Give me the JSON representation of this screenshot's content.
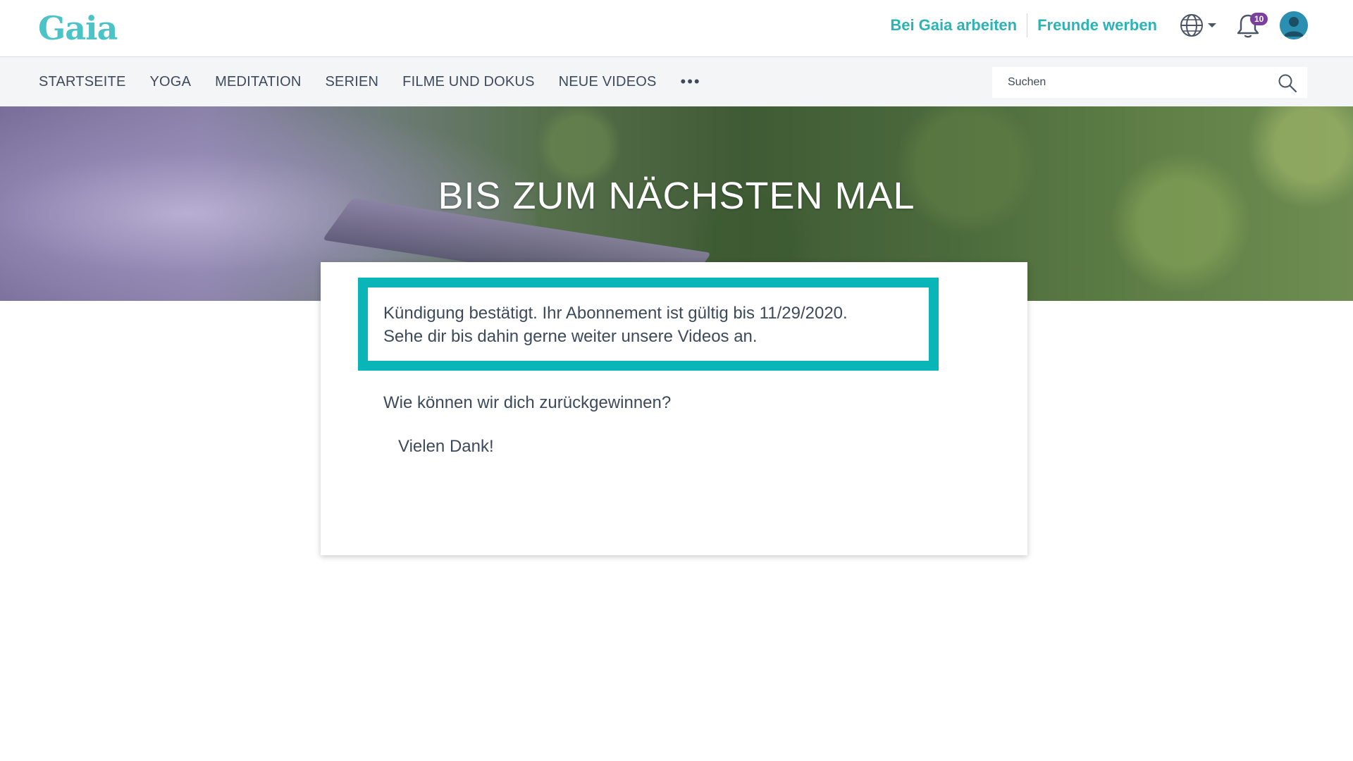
{
  "header": {
    "logo": "Gaia",
    "links": [
      {
        "label": "Bei Gaia arbeiten"
      },
      {
        "label": "Freunde werben"
      }
    ],
    "notification_count": "10",
    "icons": {
      "globe": "globe-icon",
      "caret": "chevron-down-icon",
      "bell": "bell-icon",
      "avatar": "avatar"
    }
  },
  "nav": {
    "items": [
      {
        "label": "STARTSEITE"
      },
      {
        "label": "YOGA"
      },
      {
        "label": "MEDITATION"
      },
      {
        "label": "SERIEN"
      },
      {
        "label": "FILME UND DOKUS"
      },
      {
        "label": "NEUE VIDEOS"
      }
    ],
    "more": "•••",
    "search": {
      "placeholder": "Suchen",
      "value": ""
    }
  },
  "hero": {
    "title": "BIS ZUM NÄCHSTEN MAL"
  },
  "card": {
    "notice_line1": "Kündigung bestätigt. Ihr Abonnement ist gültig bis 11/29/2020.",
    "notice_line2": "Sehe dir bis dahin gerne weiter unsere Videos an.",
    "question": "Wie können wir dich zurückgewinnen?",
    "thanks": "Vielen Dank!"
  },
  "colors": {
    "brand": "#4cc3c7",
    "link": "#2bb3b6",
    "notice_border": "#0ab5b7",
    "badge": "#7b3f9e",
    "text": "#3d4a5c",
    "nav_bg": "#f4f5f7"
  }
}
